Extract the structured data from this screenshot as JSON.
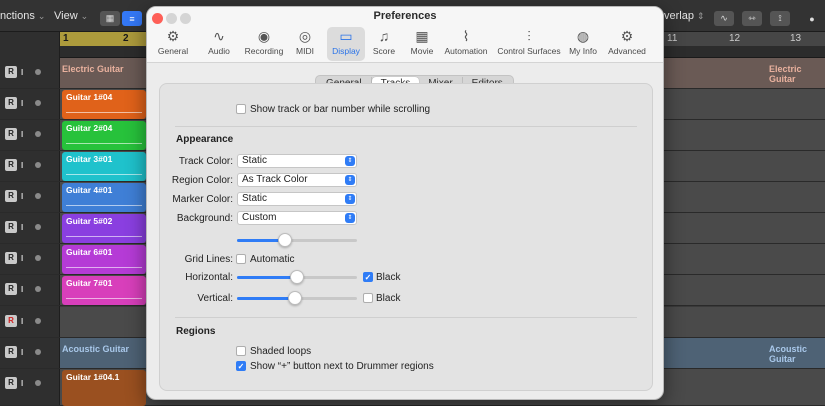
{
  "daw": {
    "toolbar": {
      "functions_menu": "nctions",
      "view_menu": "View",
      "overlap_menu": "verlap"
    },
    "ruler_left": [
      "1",
      "2"
    ],
    "ruler_right": [
      "11",
      "12",
      "13"
    ],
    "folder_electric": "Electric Guitar",
    "folder_electric_right": "Electric Guitar",
    "folder_acoustic": "Acoustic Guitar",
    "folder_acoustic_right": "Acoustic Guitar",
    "regions": [
      {
        "name": "Guitar 1#04",
        "color": "#e0621a"
      },
      {
        "name": "Guitar 2#04",
        "color": "#27c23b"
      },
      {
        "name": "Guitar 3#01",
        "color": "#1fc2cc"
      },
      {
        "name": "Guitar 4#01",
        "color": "#3f7fd6"
      },
      {
        "name": "Guitar 5#02",
        "color": "#8a3fe0"
      },
      {
        "name": "Guitar 6#01",
        "color": "#b53bd6"
      },
      {
        "name": "Guitar 7#01",
        "color": "#d83fbb"
      }
    ],
    "acoustic_region": {
      "name": "Guitar 1#04.1",
      "color": "#9a5020"
    },
    "track_rec": "R",
    "track_input": "I"
  },
  "prefs": {
    "title": "Preferences",
    "tabs": [
      {
        "label": "General",
        "icon": "gear-icon",
        "glyph": "⚙"
      },
      {
        "label": "Audio",
        "icon": "waveform-icon",
        "glyph": "∿"
      },
      {
        "label": "Recording",
        "icon": "record-icon",
        "glyph": "◉"
      },
      {
        "label": "MIDI",
        "icon": "midi-icon",
        "glyph": "◎"
      },
      {
        "label": "Display",
        "icon": "display-icon",
        "glyph": "▭"
      },
      {
        "label": "Score",
        "icon": "score-icon",
        "glyph": "♫"
      },
      {
        "label": "Movie",
        "icon": "movie-icon",
        "glyph": "▦"
      },
      {
        "label": "Automation",
        "icon": "automation-icon",
        "glyph": "⌇"
      },
      {
        "label": "Control Surfaces",
        "icon": "control-surfaces-icon",
        "glyph": "⫶"
      },
      {
        "label": "My Info",
        "icon": "my-info-icon",
        "glyph": "◍"
      },
      {
        "label": "Advanced",
        "icon": "advanced-icon",
        "glyph": "⚙"
      }
    ],
    "active_tab": "Display",
    "subtabs": [
      "General",
      "Tracks",
      "Mixer",
      "Editors"
    ],
    "active_subtab": "Tracks",
    "show_track_number": {
      "label": "Show track or bar number while scrolling",
      "checked": false
    },
    "appearance": {
      "heading": "Appearance",
      "track_color": {
        "label": "Track Color:",
        "value": "Static"
      },
      "region_color": {
        "label": "Region Color:",
        "value": "As Track Color"
      },
      "marker_color": {
        "label": "Marker Color:",
        "value": "Static"
      },
      "background": {
        "label": "Background:",
        "value": "Custom",
        "slider_value": 0.4
      },
      "grid_lines": {
        "label": "Grid Lines:",
        "automatic_label": "Automatic",
        "automatic_checked": false
      },
      "horizontal": {
        "label": "Horizontal:",
        "slider_value": 0.5,
        "black_label": "Black",
        "black_checked": true
      },
      "vertical": {
        "label": "Vertical:",
        "slider_value": 0.48,
        "black_label": "Black",
        "black_checked": false
      }
    },
    "regions": {
      "heading": "Regions",
      "shaded_loops": {
        "label": "Shaded loops",
        "checked": false
      },
      "drummer_plus": {
        "label": "Show “+” button next to Drummer regions",
        "checked": true
      }
    }
  }
}
